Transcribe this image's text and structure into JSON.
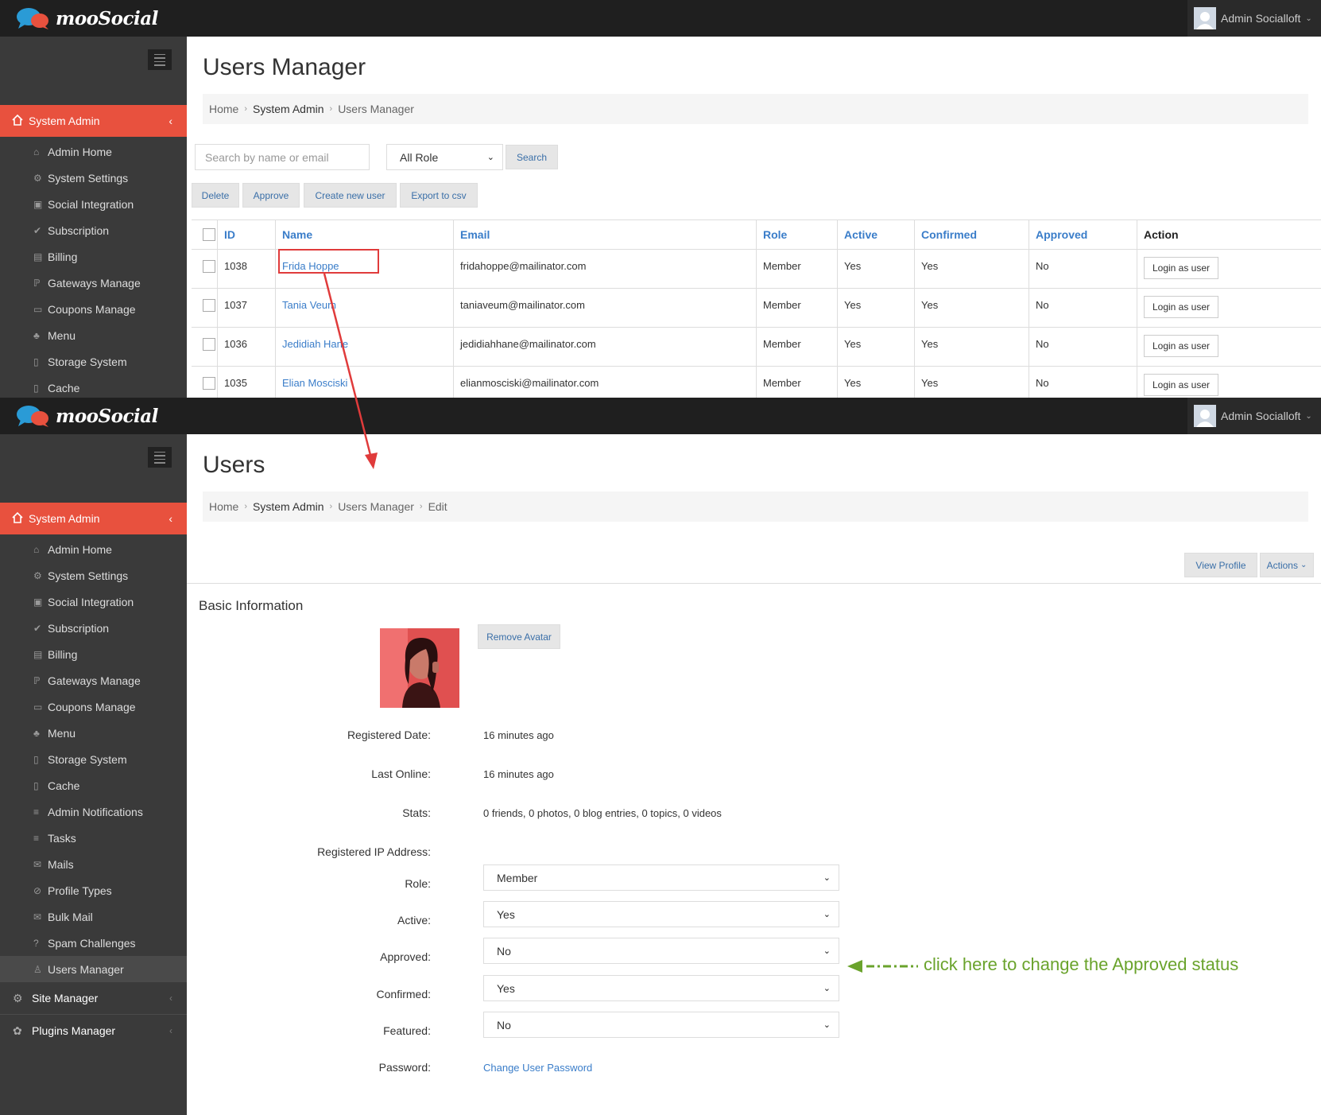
{
  "app": {
    "logo_text": "mooSocial",
    "user_name": "Admin Socialloft"
  },
  "sidebar": {
    "system_admin_label": "System Admin",
    "items": [
      {
        "label": "Admin Home",
        "icon": "home-icon",
        "glyph": "⌂"
      },
      {
        "label": "System Settings",
        "icon": "gear-icon",
        "glyph": "⚙"
      },
      {
        "label": "Social Integration",
        "icon": "share-icon",
        "glyph": "▣"
      },
      {
        "label": "Subscription",
        "icon": "check-icon",
        "glyph": "✔"
      },
      {
        "label": "Billing",
        "icon": "card-icon",
        "glyph": "▤"
      },
      {
        "label": "Gateways Manage",
        "icon": "paypal-icon",
        "glyph": "ℙ"
      },
      {
        "label": "Coupons Manage",
        "icon": "money-icon",
        "glyph": "▭"
      },
      {
        "label": "Menu",
        "icon": "sitemap-icon",
        "glyph": "♣"
      },
      {
        "label": "Storage System",
        "icon": "file-icon",
        "glyph": "▯"
      },
      {
        "label": "Cache",
        "icon": "file-icon",
        "glyph": "▯"
      },
      {
        "label": "Admin Notifications",
        "icon": "list-icon",
        "glyph": "≡"
      },
      {
        "label": "Tasks",
        "icon": "list-icon",
        "glyph": "≡"
      },
      {
        "label": "Mails",
        "icon": "mail-icon",
        "glyph": "✉"
      },
      {
        "label": "Profile Types",
        "icon": "circle-check-icon",
        "glyph": "⊘"
      },
      {
        "label": "Bulk Mail",
        "icon": "mail-icon",
        "glyph": "✉"
      },
      {
        "label": "Spam Challenges",
        "icon": "question-icon",
        "glyph": "?"
      },
      {
        "label": "Users Manager",
        "icon": "user-icon",
        "glyph": "♙"
      }
    ],
    "site_manager_label": "Site Manager",
    "plugins_manager_label": "Plugins Manager"
  },
  "list_page": {
    "title": "Users Manager",
    "breadcrumb": [
      "Home",
      "System Admin",
      "Users Manager"
    ],
    "search_placeholder": "Search by name or email",
    "role_select": "All Role",
    "search_btn": "Search",
    "buttons": {
      "delete": "Delete",
      "approve": "Approve",
      "create": "Create new user",
      "export": "Export to csv"
    },
    "columns": {
      "id": "ID",
      "name": "Name",
      "email": "Email",
      "role": "Role",
      "active": "Active",
      "confirmed": "Confirmed",
      "approved": "Approved",
      "action": "Action"
    },
    "rows": [
      {
        "id": "1038",
        "name": "Frida Hoppe",
        "email": "fridahoppe@mailinator.com",
        "role": "Member",
        "active": "Yes",
        "confirmed": "Yes",
        "approved": "No",
        "action": "Login as user"
      },
      {
        "id": "1037",
        "name": "Tania Veum",
        "email": "taniaveum@mailinator.com",
        "role": "Member",
        "active": "Yes",
        "confirmed": "Yes",
        "approved": "No",
        "action": "Login as user"
      },
      {
        "id": "1036",
        "name": "Jedidiah Hane",
        "email": "jedidiahhane@mailinator.com",
        "role": "Member",
        "active": "Yes",
        "confirmed": "Yes",
        "approved": "No",
        "action": "Login as user"
      },
      {
        "id": "1035",
        "name": "Elian Mosciski",
        "email": "elianmosciski@mailinator.com",
        "role": "Member",
        "active": "Yes",
        "confirmed": "Yes",
        "approved": "No",
        "action": "Login as user"
      }
    ]
  },
  "edit_page": {
    "title": "Users",
    "breadcrumb": [
      "Home",
      "System Admin",
      "Users Manager",
      "Edit"
    ],
    "view_profile_btn": "View Profile",
    "actions_btn": "Actions",
    "basic_info_title": "Basic Information",
    "remove_avatar_btn": "Remove Avatar",
    "labels": {
      "registered_date": "Registered Date:",
      "last_online": "Last Online:",
      "stats": "Stats:",
      "registered_ip": "Registered IP Address:",
      "role": "Role:",
      "active": "Active:",
      "approved": "Approved:",
      "confirmed": "Confirmed:",
      "featured": "Featured:",
      "password": "Password:"
    },
    "values": {
      "registered_date": "16 minutes ago",
      "last_online": "16 minutes ago",
      "stats": "0 friends, 0 photos, 0 blog entries, 0 topics, 0 videos",
      "registered_ip": "",
      "role": "Member",
      "active": "Yes",
      "approved": "No",
      "confirmed": "Yes",
      "featured": "No",
      "password_link": "Change User Password"
    }
  },
  "annotation": {
    "text": "click here to change the Approved status"
  },
  "colors": {
    "accent": "#e8513e",
    "link": "#3a7dc9",
    "topbar": "#1f1f1f",
    "sidebar": "#3a3a3a",
    "annotation": "#6aa32c",
    "highlight": "#e03b3b"
  }
}
